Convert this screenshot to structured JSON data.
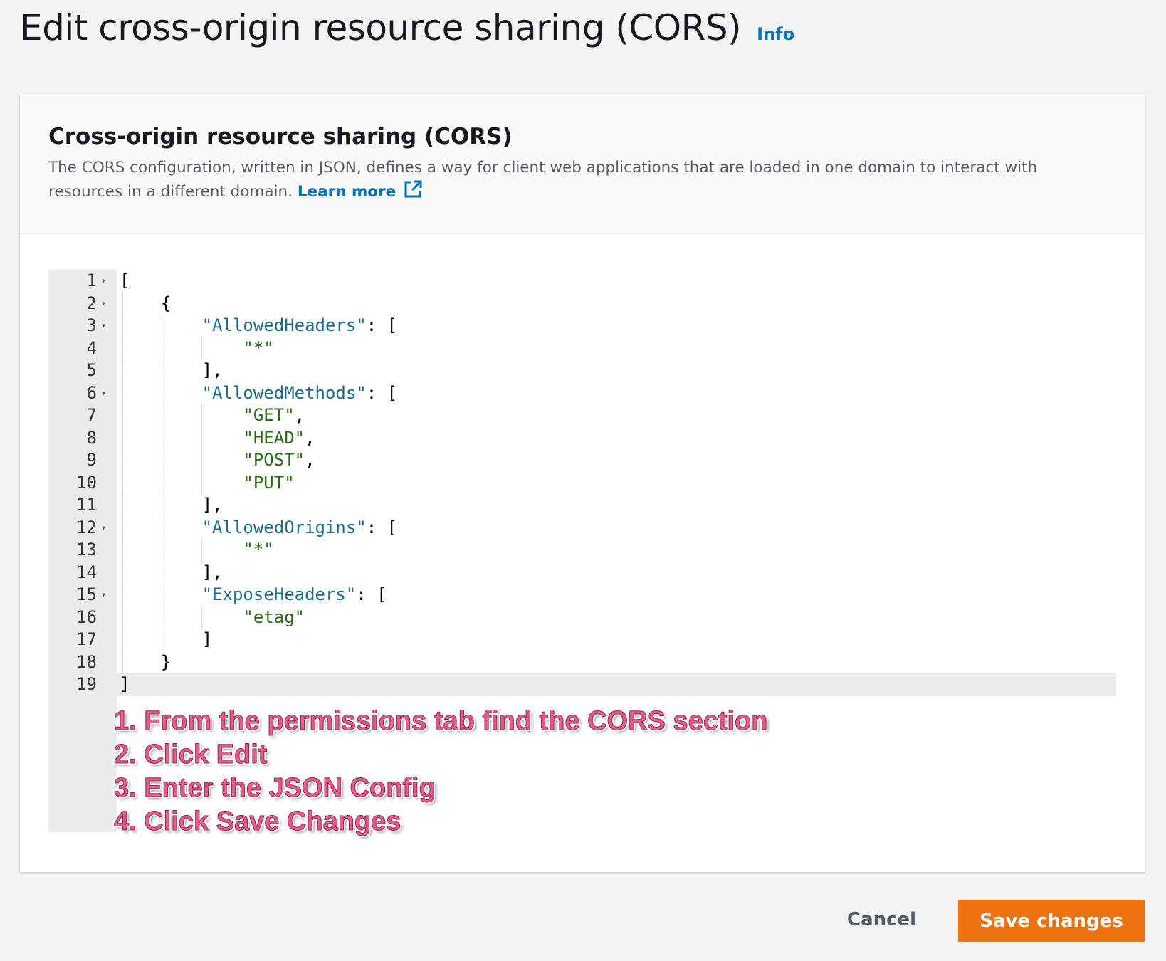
{
  "header": {
    "title": "Edit cross-origin resource sharing (CORS)",
    "info_label": "Info"
  },
  "panel": {
    "title": "Cross-origin resource sharing (CORS)",
    "description": "The CORS configuration, written in JSON, defines a way for client web applications that are loaded in one domain to interact with resources in a different domain.",
    "learn_more_label": "Learn more",
    "learn_more_icon": "external-link-icon"
  },
  "editor": {
    "active_line": 19,
    "lines": [
      {
        "num": "1",
        "text": "[",
        "fold": true
      },
      {
        "num": "2",
        "text": "    {",
        "fold": true
      },
      {
        "num": "3",
        "text": "        \"AllowedHeaders\": [",
        "fold": true
      },
      {
        "num": "4",
        "text": "            \"*\"",
        "fold": false
      },
      {
        "num": "5",
        "text": "        ],",
        "fold": false
      },
      {
        "num": "6",
        "text": "        \"AllowedMethods\": [",
        "fold": true
      },
      {
        "num": "7",
        "text": "            \"GET\",",
        "fold": false
      },
      {
        "num": "8",
        "text": "            \"HEAD\",",
        "fold": false
      },
      {
        "num": "9",
        "text": "            \"POST\",",
        "fold": false
      },
      {
        "num": "10",
        "text": "            \"PUT\"",
        "fold": false
      },
      {
        "num": "11",
        "text": "        ],",
        "fold": false
      },
      {
        "num": "12",
        "text": "        \"AllowedOrigins\": [",
        "fold": true
      },
      {
        "num": "13",
        "text": "            \"*\"",
        "fold": false
      },
      {
        "num": "14",
        "text": "        ],",
        "fold": false
      },
      {
        "num": "15",
        "text": "        \"ExposeHeaders\": [",
        "fold": true
      },
      {
        "num": "16",
        "text": "            \"etag\"",
        "fold": false
      },
      {
        "num": "17",
        "text": "        ]",
        "fold": false
      },
      {
        "num": "18",
        "text": "    }",
        "fold": false
      },
      {
        "num": "19",
        "text": "]",
        "fold": false
      }
    ]
  },
  "annotations": [
    "1. From the permissions tab find the CORS section",
    "2. Click Edit",
    "3. Enter the JSON Config",
    "4. Click Save Changes"
  ],
  "footer": {
    "cancel_label": "Cancel",
    "save_label": "Save changes"
  },
  "colors": {
    "accent": "#ec7211",
    "link": "#0073bb",
    "annotation": "#e85a8a"
  }
}
